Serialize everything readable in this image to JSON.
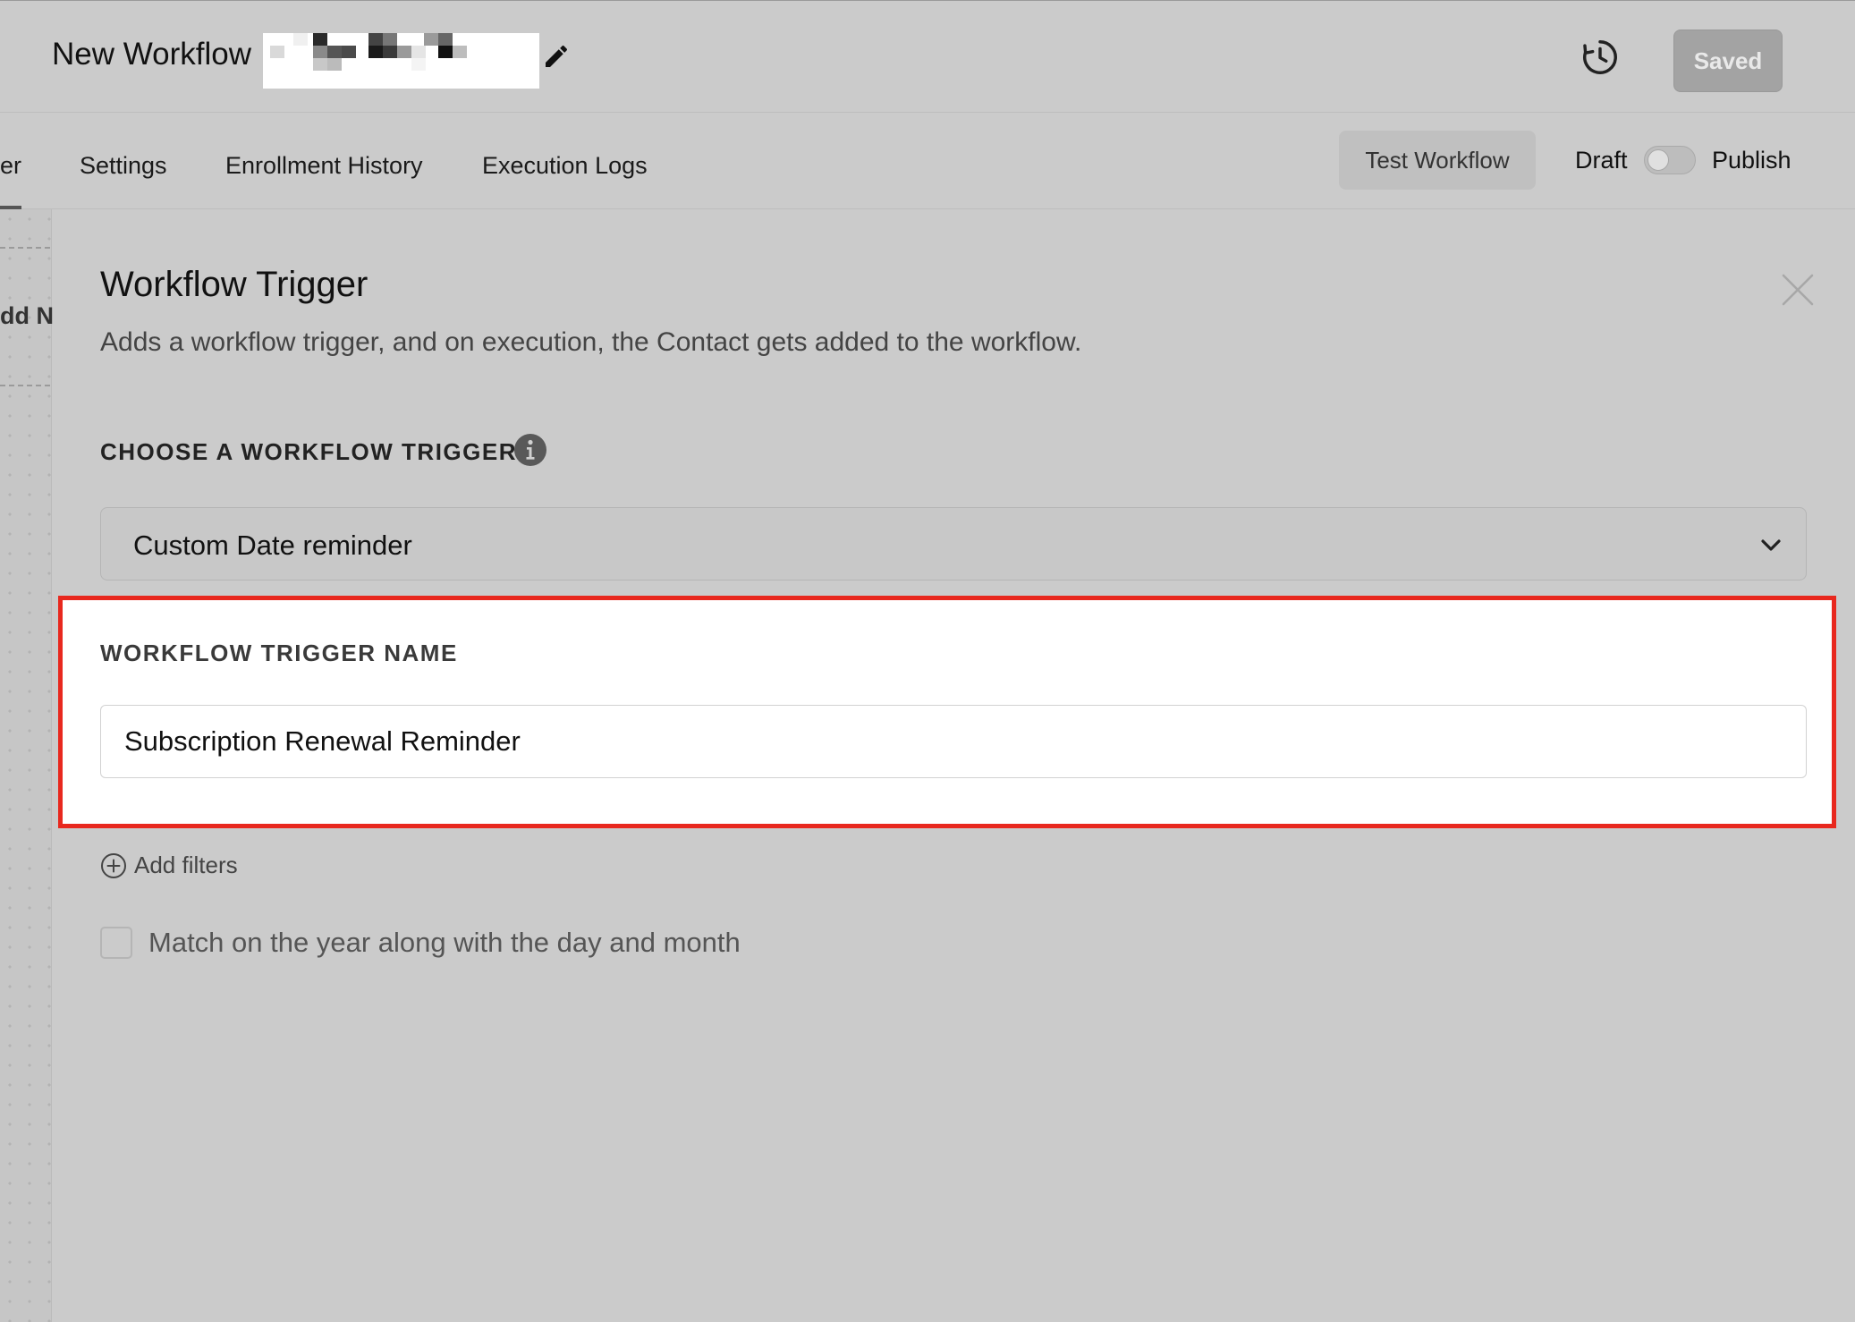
{
  "header": {
    "title": "New Workflow",
    "saved_label": "Saved"
  },
  "tabs": [
    {
      "label": "er"
    },
    {
      "label": "Settings"
    },
    {
      "label": "Enrollment History"
    },
    {
      "label": "Execution Logs"
    }
  ],
  "actions": {
    "test_label": "Test Workflow",
    "draft_label": "Draft",
    "publish_label": "Publish",
    "publish_toggle_on": false
  },
  "canvas": {
    "partial_node_text": "dd N"
  },
  "panel": {
    "title": "Workflow Trigger",
    "description": "Adds a workflow trigger, and on execution, the Contact gets added to the workflow.",
    "choose_label": "CHOOSE A WORKFLOW TRIGGER",
    "selected_trigger": "Custom Date reminder",
    "trigger_name_label": "WORKFLOW TRIGGER NAME",
    "trigger_name_value": "Subscription Renewal Reminder",
    "add_filters_label": "Add filters",
    "match_year_label": "Match on the year along with the day and month",
    "match_year_checked": false
  },
  "colors": {
    "highlight_border": "#e8281e",
    "overlay_gray": "#cbcbcb"
  },
  "icons": [
    "edit-icon",
    "history-icon",
    "close-icon",
    "info-icon",
    "chevron-down-icon",
    "plus-circle-icon"
  ]
}
